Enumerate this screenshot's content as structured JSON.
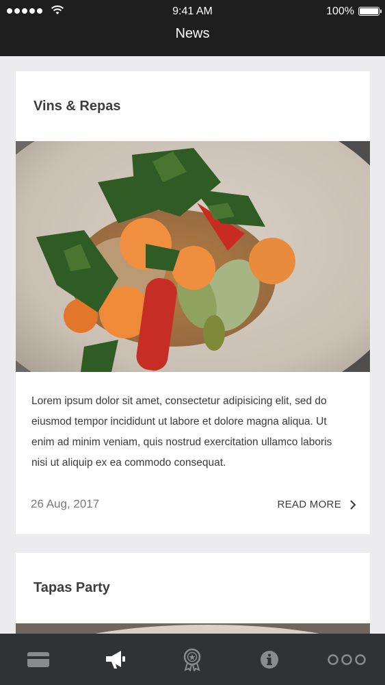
{
  "status_bar": {
    "time": "9:41 AM",
    "battery": "100%"
  },
  "header": {
    "title": "News"
  },
  "cards": [
    {
      "title": "Vins & Repas",
      "body": "Lorem ipsum dolor sit amet, consectetur adipisicing elit, sed do eiusmod tempor incididunt ut labore et dolore magna aliqua. Ut enim ad minim veniam, quis nostrud exercitation ullamco laboris nisi ut aliquip ex ea commodo consequat.",
      "date": "26 Aug, 2017",
      "read_more": "READ MORE"
    },
    {
      "title": "Tapas Party"
    }
  ],
  "tabbar": {
    "items": [
      {
        "icon": "card-icon",
        "active": false
      },
      {
        "icon": "megaphone-icon",
        "active": true
      },
      {
        "icon": "award-icon",
        "active": false
      },
      {
        "icon": "info-icon",
        "active": false
      },
      {
        "icon": "more-icon",
        "active": false
      }
    ]
  },
  "colors": {
    "bar": "#1e1e1f",
    "tabbar": "#313234",
    "background": "#ececee",
    "active_icon": "#ffffff",
    "inactive_icon": "#8a8b8d"
  }
}
